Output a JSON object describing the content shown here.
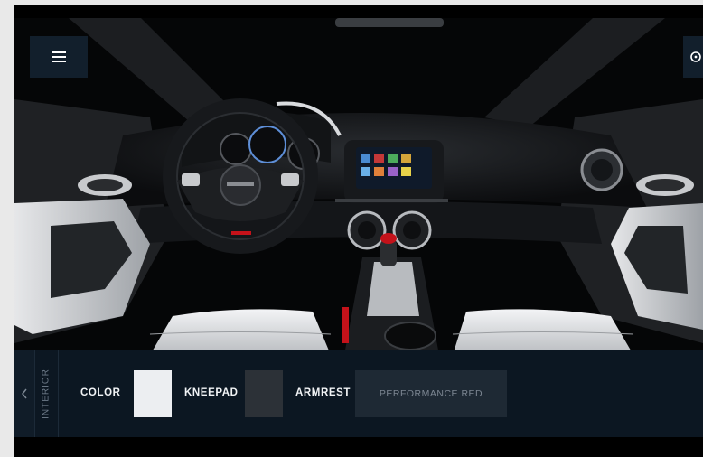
{
  "toolbar": {
    "section_label": "INTERIOR",
    "color_label": "COLOR",
    "kneepad_label": "KNEEPAD",
    "armrest_label": "ARMREST",
    "option_button_label": "PERFORMANCE RED"
  },
  "swatches": {
    "color": "#eceef1",
    "kneepad": "#2c3137"
  },
  "icons": {
    "menu": "hamburger-menu-icon",
    "previous": "chevron-left-icon",
    "side": "steering-wheel-icon"
  }
}
